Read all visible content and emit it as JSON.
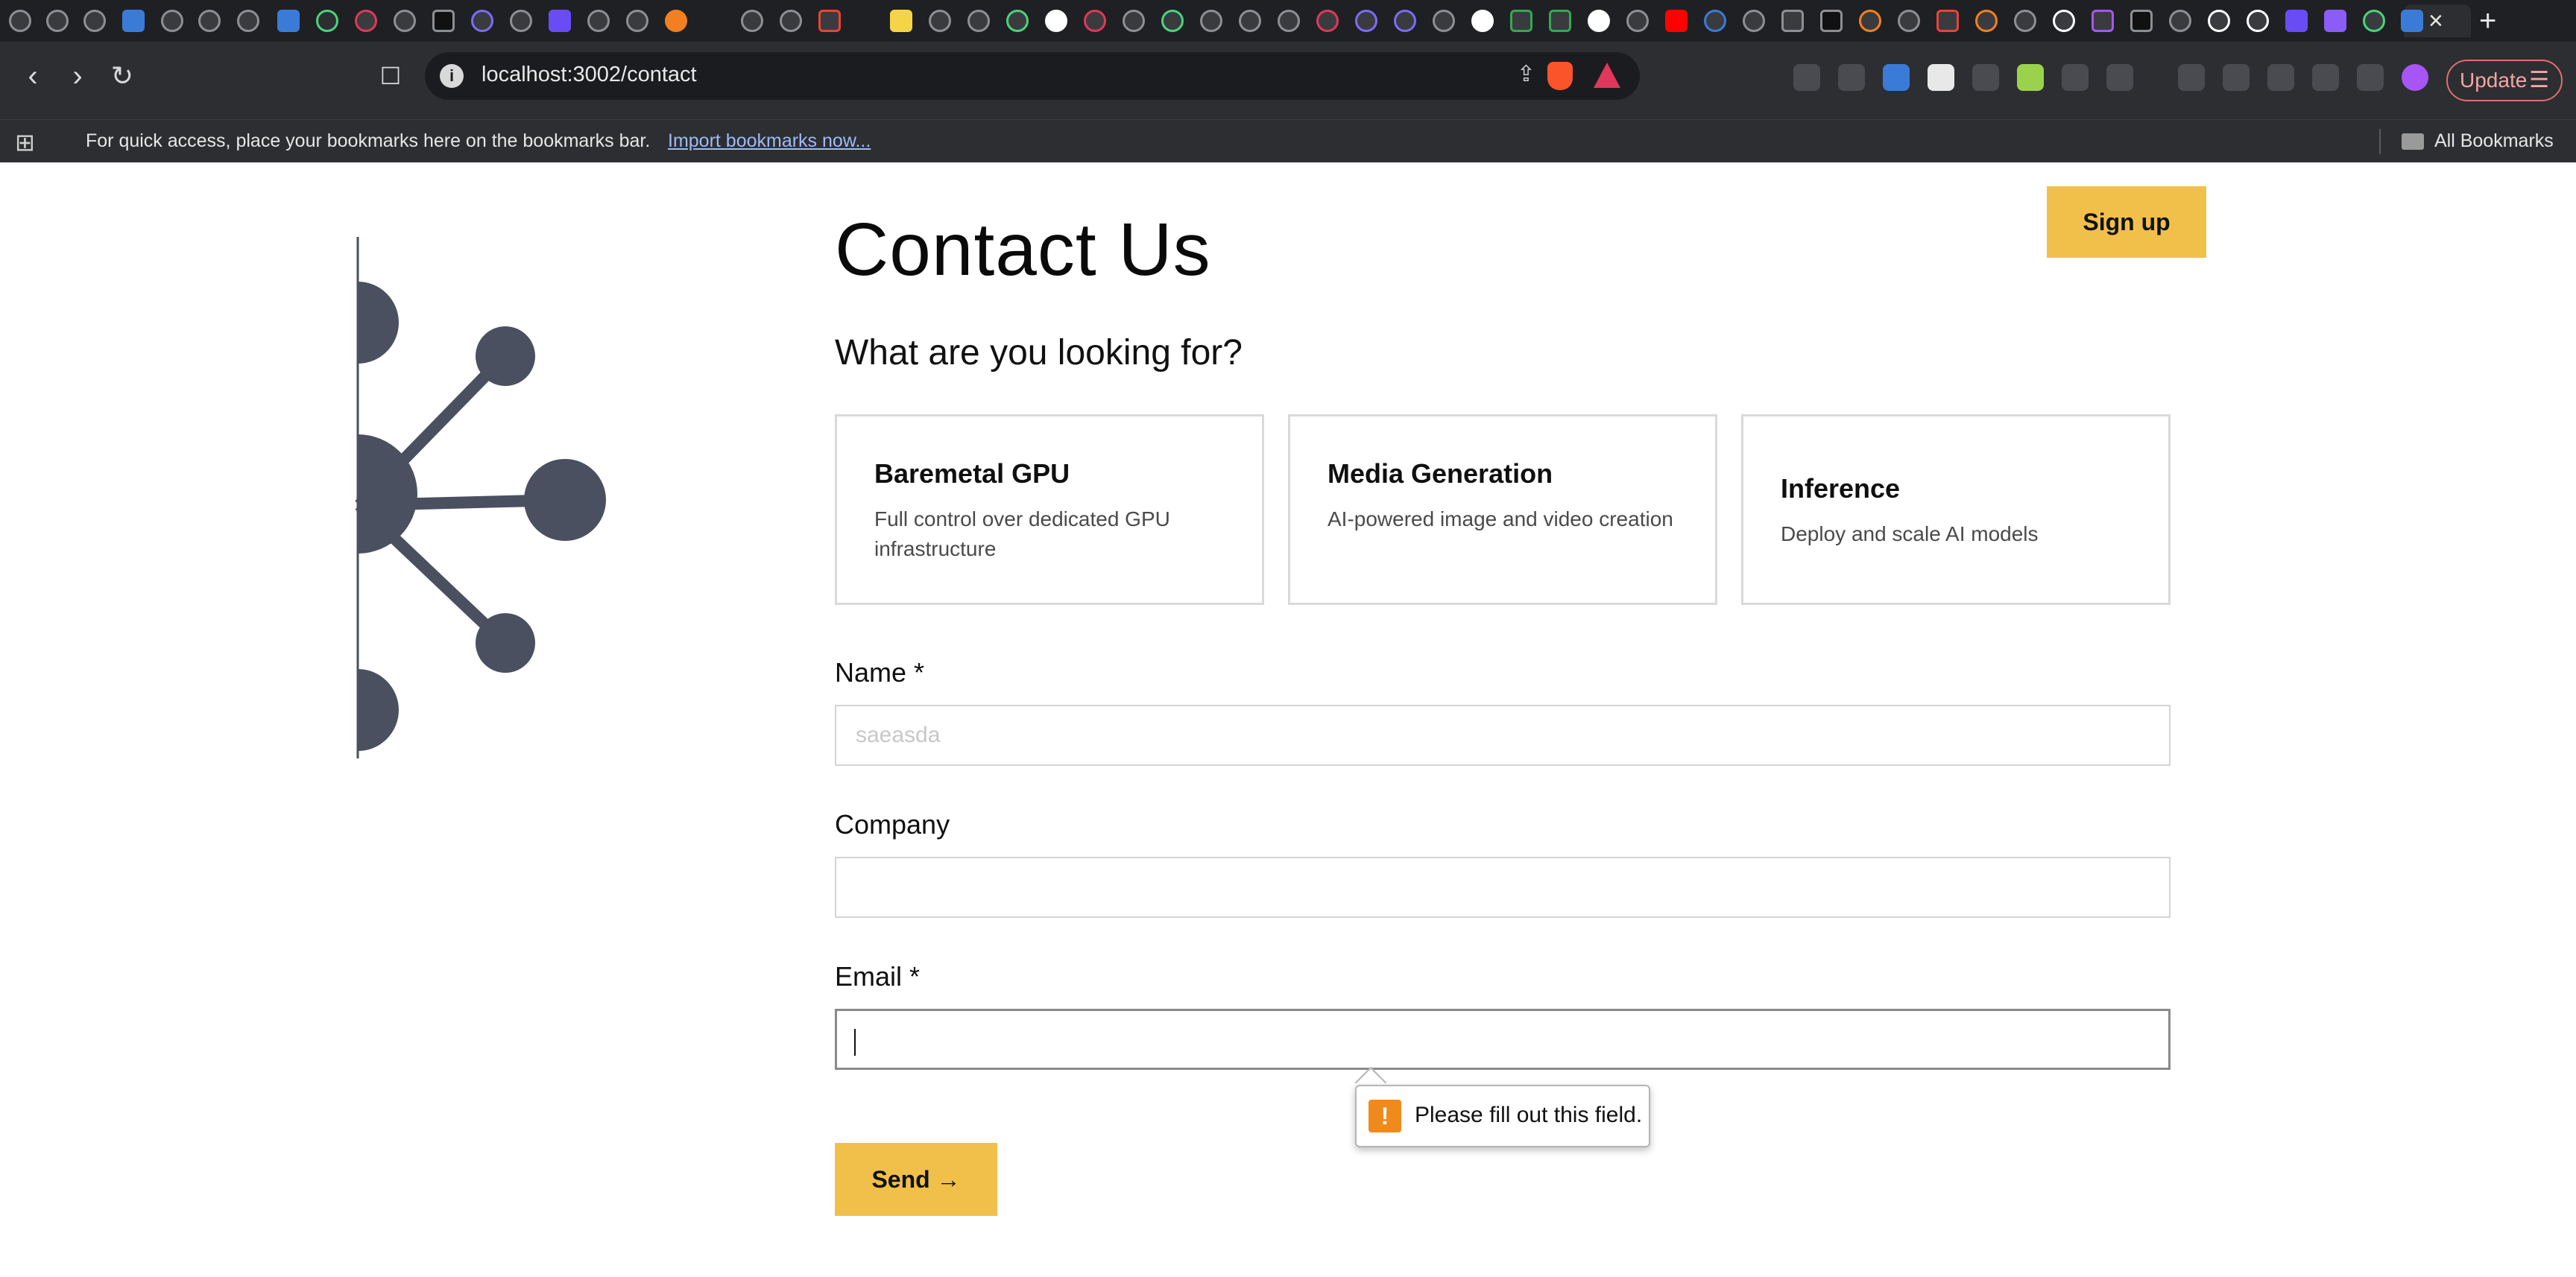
{
  "browser": {
    "url": "localhost:3002/contact",
    "update_label": "Update",
    "bookmarks_prompt": "For quick access, place your bookmarks here on the bookmarks bar.",
    "import_link": "Import bookmarks now...",
    "all_bookmarks": "All Bookmarks"
  },
  "header": {
    "title": "Contact Us",
    "signup_label": "Sign up"
  },
  "form": {
    "question": "What are you looking for?",
    "options": [
      {
        "title": "Baremetal GPU",
        "description": "Full control over dedicated GPU infrastructure"
      },
      {
        "title": "Media Generation",
        "description": "AI-powered image and video creation"
      },
      {
        "title": "Inference",
        "description": "Deploy and scale AI models"
      }
    ],
    "name_label": "Name *",
    "name_placeholder": "saeasda",
    "company_label": "Company",
    "email_label": "Email *",
    "validation_message": "Please fill out this field.",
    "send_label": "Send →"
  },
  "colors": {
    "accent": "#f0c04a",
    "illustration": "#4a5060",
    "warning": "#f08a1c"
  }
}
